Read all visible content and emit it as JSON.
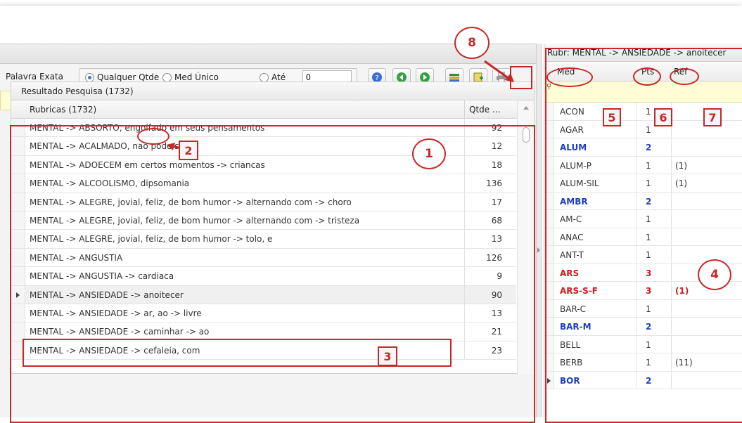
{
  "toolbar": {
    "palavra_exata": "Palavra Exata",
    "radio_qualquer": "Qualquer Qtde",
    "radio_med_unico": "Med Único",
    "radio_ate": "Até",
    "ate_value": "0"
  },
  "results": {
    "title_prefix": "Resultado Pesquisa",
    "count": "(1732)",
    "col_rubricas": "Rubricas (1732)",
    "col_qtde": "Qtde ...",
    "rows": [
      {
        "label": "MENTAL -> ABSORTO, engolfado em seus pensamentos",
        "qtde": "92"
      },
      {
        "label": "MENTAL -> ACALMADO, nao pode ser",
        "qtde": "12"
      },
      {
        "label": "MENTAL -> ADOECEM em certos momentos -> criancas",
        "qtde": "18"
      },
      {
        "label": "MENTAL -> ALCOOLISMO, dipsomania",
        "qtde": "136"
      },
      {
        "label": "MENTAL -> ALEGRE, jovial, feliz, de bom humor -> alternando com -> choro",
        "qtde": "17"
      },
      {
        "label": "MENTAL -> ALEGRE, jovial, feliz, de bom humor -> alternando com -> tristeza",
        "qtde": "68"
      },
      {
        "label": "MENTAL -> ALEGRE, jovial, feliz, de bom humor -> tolo, e",
        "qtde": "13"
      },
      {
        "label": "MENTAL -> ANGUSTIA",
        "qtde": "126"
      },
      {
        "label": "MENTAL -> ANGUSTIA -> cardiaca",
        "qtde": "9"
      },
      {
        "label": "MENTAL -> ANSIEDADE -> anoitecer",
        "qtde": "90"
      },
      {
        "label": "MENTAL -> ANSIEDADE -> ar, ao -> livre",
        "qtde": "13"
      },
      {
        "label": "MENTAL -> ANSIEDADE -> caminhar -> ao",
        "qtde": "21"
      },
      {
        "label": "MENTAL -> ANSIEDADE -> cefaleia, com",
        "qtde": "23"
      }
    ]
  },
  "right": {
    "title": "Rubr: MENTAL -> ANSIEDADE -> anoitecer",
    "col_med": "Med",
    "col_pts": "Pts",
    "col_ref": "Ref",
    "rows": [
      {
        "med": "ACON",
        "pts": "1",
        "ref": ""
      },
      {
        "med": "AGAR",
        "pts": "1",
        "ref": ""
      },
      {
        "med": "ALUM",
        "pts": "2",
        "ref": ""
      },
      {
        "med": "ALUM-P",
        "pts": "1",
        "ref": "(1)"
      },
      {
        "med": "ALUM-SIL",
        "pts": "1",
        "ref": "(1)"
      },
      {
        "med": "AMBR",
        "pts": "2",
        "ref": ""
      },
      {
        "med": "AM-C",
        "pts": "1",
        "ref": ""
      },
      {
        "med": "ANAC",
        "pts": "1",
        "ref": ""
      },
      {
        "med": "ANT-T",
        "pts": "1",
        "ref": ""
      },
      {
        "med": "ARS",
        "pts": "3",
        "ref": ""
      },
      {
        "med": "ARS-S-F",
        "pts": "3",
        "ref": "(1)"
      },
      {
        "med": "BAR-C",
        "pts": "1",
        "ref": ""
      },
      {
        "med": "BAR-M",
        "pts": "2",
        "ref": ""
      },
      {
        "med": "BELL",
        "pts": "1",
        "ref": ""
      },
      {
        "med": "BERB",
        "pts": "1",
        "ref": "(11)"
      },
      {
        "med": "BOR",
        "pts": "2",
        "ref": ""
      }
    ]
  },
  "annotations": {
    "n1": "1",
    "n2": "2",
    "n3": "3",
    "n4": "4",
    "n5": "5",
    "n6": "6",
    "n7": "7",
    "n8": "8"
  },
  "colors": {
    "pts2": "#1d3fbf",
    "pts3": "#d01c1c",
    "annotation": "#c62828",
    "filter_bg": "#fffdd6"
  },
  "icons": [
    "help-icon",
    "prev-green-icon",
    "next-green-icon",
    "books-icon",
    "note-add-icon",
    "printer-icon",
    "edit-icon",
    "copy-icon",
    "paste-icon"
  ]
}
